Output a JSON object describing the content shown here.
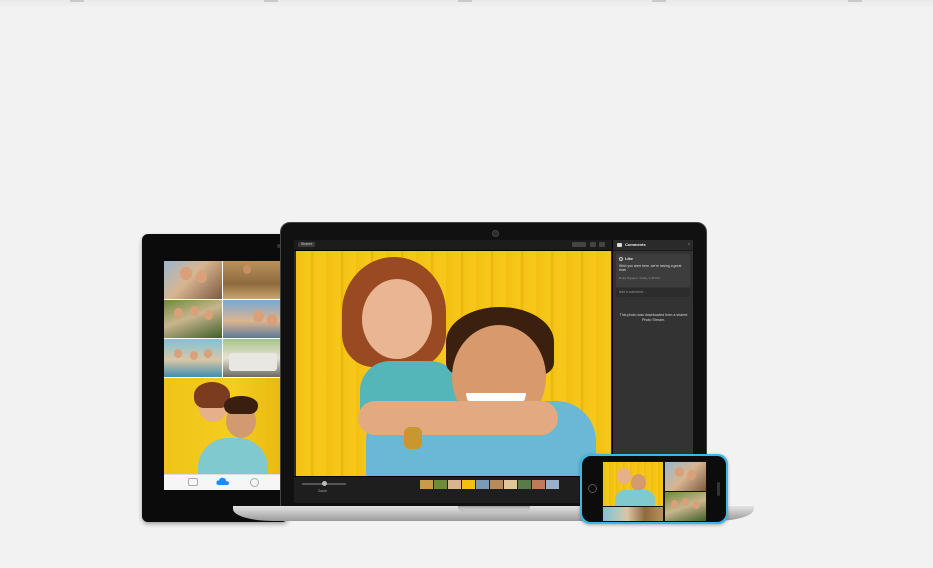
{
  "colors": {
    "background": "#f2f2f2",
    "photo_yellow": "#f5c418",
    "iphone_blue": "#3eb7e4"
  },
  "ipad": {
    "tabbar": {
      "left_label": "Photos",
      "center_label": "Shared",
      "right_label": "Albums"
    },
    "icons": [
      "photos-tab-icon",
      "icloud-shared-icon",
      "albums-tab-icon"
    ]
  },
  "mac": {
    "toolbar": {
      "back_label": "Shared"
    },
    "filmstrip": {
      "zoom_label": "Zoom"
    },
    "comments": {
      "title": "Comments",
      "like_label": "Like",
      "message": "Wish you were here, we're having a great time!",
      "meta": "Emily Nguyen, Today, 9:45 PM",
      "add_comment": "Add a comment...",
      "note": "This photo was downloaded from a shared Photo Stream."
    }
  }
}
